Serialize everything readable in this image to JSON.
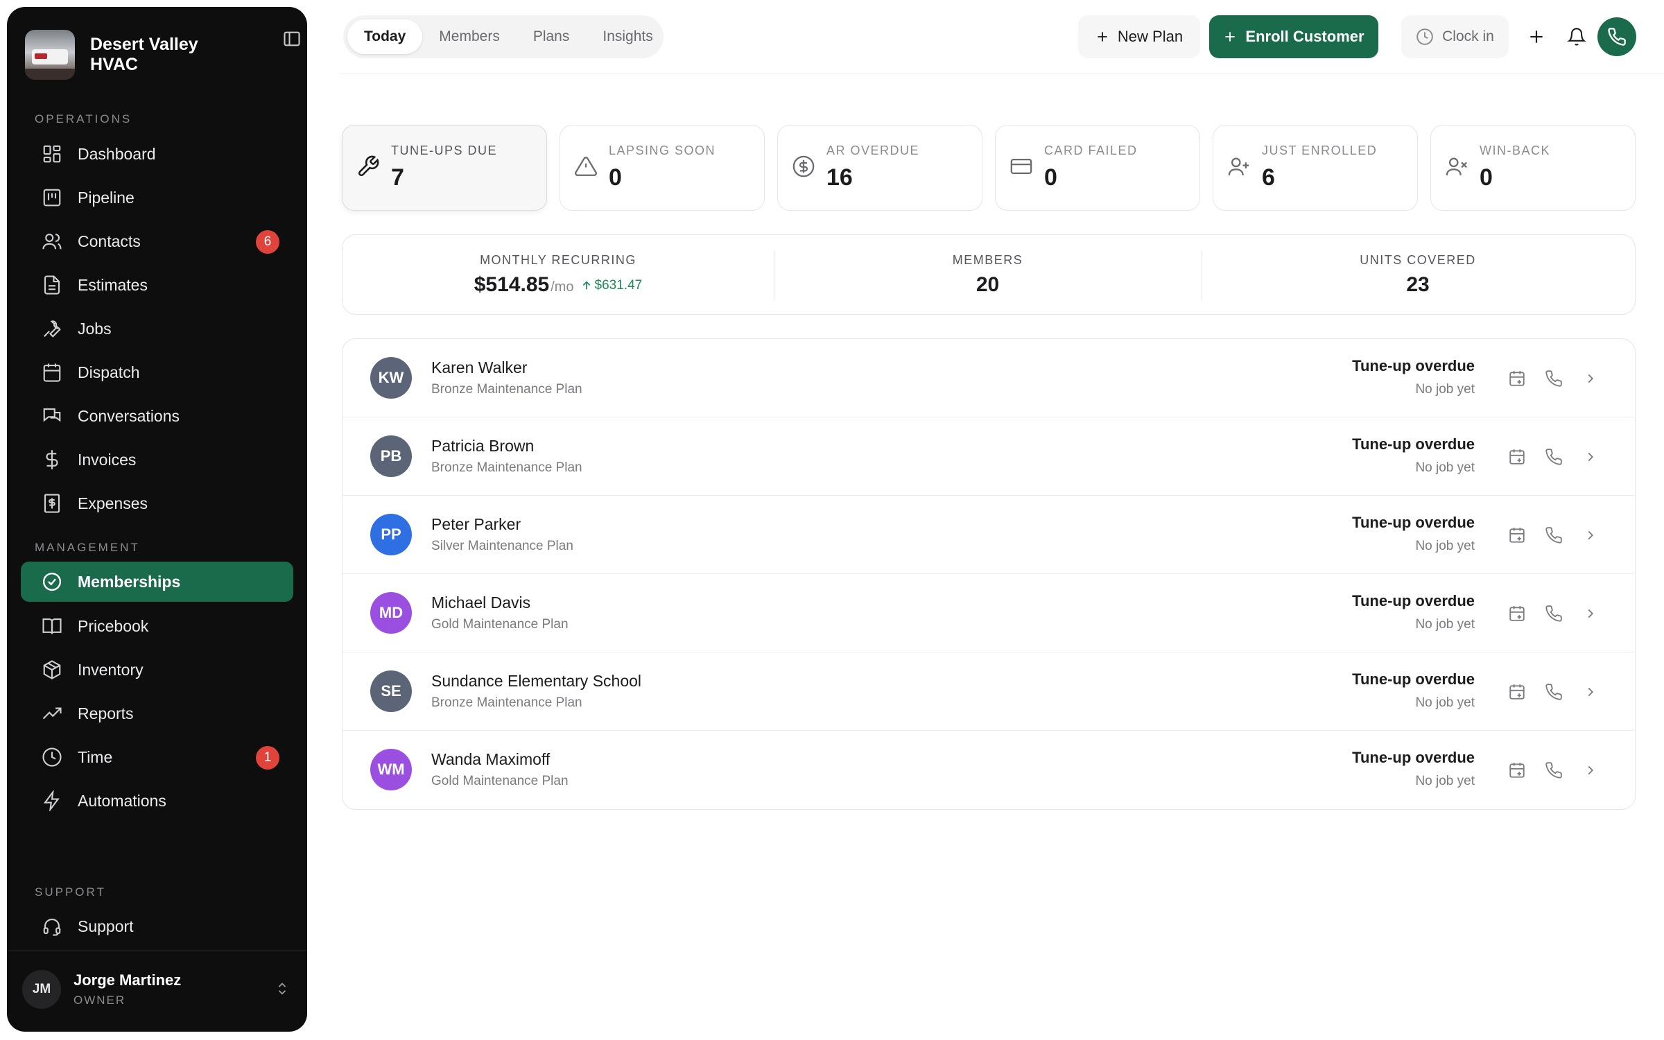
{
  "brand": {
    "name": "Desert Valley HVAC"
  },
  "sidebar": {
    "sections": [
      {
        "label": "OPERATIONS"
      },
      {
        "label": "MANAGEMENT"
      },
      {
        "label": "SUPPORT"
      }
    ],
    "items": [
      {
        "label": "Dashboard",
        "icon": "dashboard-icon"
      },
      {
        "label": "Pipeline",
        "icon": "pipeline-icon"
      },
      {
        "label": "Contacts",
        "icon": "users-icon",
        "badge": "6"
      },
      {
        "label": "Estimates",
        "icon": "file-text-icon"
      },
      {
        "label": "Jobs",
        "icon": "wrench-icon"
      },
      {
        "label": "Dispatch",
        "icon": "calendar-icon"
      },
      {
        "label": "Conversations",
        "icon": "chat-icon"
      },
      {
        "label": "Invoices",
        "icon": "dollar-icon"
      },
      {
        "label": "Expenses",
        "icon": "receipt-icon"
      },
      {
        "label": "Memberships",
        "icon": "badge-check-icon",
        "active": true
      },
      {
        "label": "Pricebook",
        "icon": "book-icon"
      },
      {
        "label": "Inventory",
        "icon": "package-icon"
      },
      {
        "label": "Reports",
        "icon": "trending-icon"
      },
      {
        "label": "Time",
        "icon": "clock-icon",
        "badge": "1"
      },
      {
        "label": "Automations",
        "icon": "bolt-icon"
      },
      {
        "label": "Support",
        "icon": "headset-icon"
      }
    ]
  },
  "user": {
    "initials": "JM",
    "name": "Jorge Martinez",
    "role": "OWNER"
  },
  "tabs": [
    {
      "label": "Today",
      "active": true
    },
    {
      "label": "Members"
    },
    {
      "label": "Plans"
    },
    {
      "label": "Insights"
    }
  ],
  "toolbar": {
    "new_plan_label": "New Plan",
    "enroll_label": "Enroll Customer",
    "clock_label": "Clock in"
  },
  "stats": [
    {
      "label": "TUNE-UPS DUE",
      "value": "7",
      "icon": "wrench-icon",
      "selected": true
    },
    {
      "label": "LAPSING SOON",
      "value": "0",
      "icon": "warning-icon"
    },
    {
      "label": "AR OVERDUE",
      "value": "16",
      "icon": "dollar-circle-icon"
    },
    {
      "label": "CARD FAILED",
      "value": "0",
      "icon": "credit-card-icon"
    },
    {
      "label": "JUST ENROLLED",
      "value": "6",
      "icon": "user-plus-icon"
    },
    {
      "label": "WIN-BACK",
      "value": "0",
      "icon": "user-x-icon"
    }
  ],
  "summary": {
    "recurring": {
      "label": "MONTHLY RECURRING",
      "value": "$514.85",
      "unit": "/mo",
      "delta": "$631.47"
    },
    "members": {
      "label": "MEMBERS",
      "value": "20"
    },
    "units": {
      "label": "UNITS COVERED",
      "value": "23"
    }
  },
  "colors": {
    "accent": "#1a6b4c",
    "badge": "#e0433a",
    "positive": "#1d8a56"
  },
  "rows": [
    {
      "initials": "KW",
      "name": "Karen Walker",
      "plan": "Bronze Maintenance Plan",
      "status": "Tune-up overdue",
      "substatus": "No job yet",
      "color": "#5b6577"
    },
    {
      "initials": "PB",
      "name": "Patricia Brown",
      "plan": "Bronze Maintenance Plan",
      "status": "Tune-up overdue",
      "substatus": "No job yet",
      "color": "#5b6577"
    },
    {
      "initials": "PP",
      "name": "Peter Parker",
      "plan": "Silver Maintenance Plan",
      "status": "Tune-up overdue",
      "substatus": "No job yet",
      "color": "#2f6fe4"
    },
    {
      "initials": "MD",
      "name": "Michael Davis",
      "plan": "Gold Maintenance Plan",
      "status": "Tune-up overdue",
      "substatus": "No job yet",
      "color": "#9b4fe0"
    },
    {
      "initials": "SE",
      "name": "Sundance Elementary School",
      "plan": "Bronze Maintenance Plan",
      "status": "Tune-up overdue",
      "substatus": "No job yet",
      "color": "#5b6577"
    },
    {
      "initials": "WM",
      "name": "Wanda Maximoff",
      "plan": "Gold Maintenance Plan",
      "status": "Tune-up overdue",
      "substatus": "No job yet",
      "color": "#9b4fe0"
    }
  ]
}
